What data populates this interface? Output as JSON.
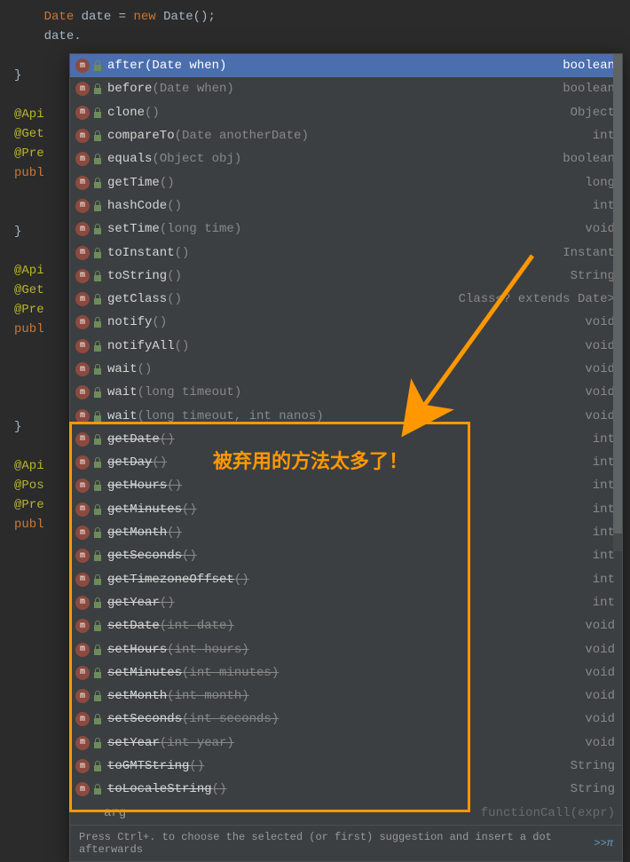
{
  "code": {
    "line1_pre": "    ",
    "line1_type": "Date",
    "line1_var": " date ",
    "line1_eq": "= ",
    "line1_new": "new",
    "line1_call": " Date();",
    "line2_pre": "    ",
    "line2_expr": "date.",
    "brace_close": "}",
    "ann1": "@Api",
    "ann2": "@Get",
    "ann3": "@Pre",
    "ann4": "@Pos",
    "publ": "publ",
    "rest_arg": "arg",
    "rest_fn": "functionCall(expr)"
  },
  "suggestions": [
    {
      "name": "after",
      "params": "(Date when)",
      "ret": "boolean",
      "deprecated": false,
      "selected": true
    },
    {
      "name": "before",
      "params": "(Date when)",
      "ret": "boolean",
      "deprecated": false
    },
    {
      "name": "clone",
      "params": "()",
      "ret": "Object",
      "deprecated": false
    },
    {
      "name": "compareTo",
      "params": "(Date anotherDate)",
      "ret": "int",
      "deprecated": false
    },
    {
      "name": "equals",
      "params": "(Object obj)",
      "ret": "boolean",
      "deprecated": false
    },
    {
      "name": "getTime",
      "params": "()",
      "ret": "long",
      "deprecated": false
    },
    {
      "name": "hashCode",
      "params": "()",
      "ret": "int",
      "deprecated": false
    },
    {
      "name": "setTime",
      "params": "(long time)",
      "ret": "void",
      "deprecated": false
    },
    {
      "name": "toInstant",
      "params": "()",
      "ret": "Instant",
      "deprecated": false
    },
    {
      "name": "toString",
      "params": "()",
      "ret": "String",
      "deprecated": false
    },
    {
      "name": "getClass",
      "params": "()",
      "ret": "Class<? extends Date>",
      "deprecated": false
    },
    {
      "name": "notify",
      "params": "()",
      "ret": "void",
      "deprecated": false
    },
    {
      "name": "notifyAll",
      "params": "()",
      "ret": "void",
      "deprecated": false
    },
    {
      "name": "wait",
      "params": "()",
      "ret": "void",
      "deprecated": false
    },
    {
      "name": "wait",
      "params": "(long timeout)",
      "ret": "void",
      "deprecated": false
    },
    {
      "name": "wait",
      "params": "(long timeout, int nanos)",
      "ret": "void",
      "deprecated": false
    },
    {
      "name": "getDate",
      "params": "()",
      "ret": "int",
      "deprecated": true
    },
    {
      "name": "getDay",
      "params": "()",
      "ret": "int",
      "deprecated": true
    },
    {
      "name": "getHours",
      "params": "()",
      "ret": "int",
      "deprecated": true
    },
    {
      "name": "getMinutes",
      "params": "()",
      "ret": "int",
      "deprecated": true
    },
    {
      "name": "getMonth",
      "params": "()",
      "ret": "int",
      "deprecated": true
    },
    {
      "name": "getSeconds",
      "params": "()",
      "ret": "int",
      "deprecated": true
    },
    {
      "name": "getTimezoneOffset",
      "params": "()",
      "ret": "int",
      "deprecated": true
    },
    {
      "name": "getYear",
      "params": "()",
      "ret": "int",
      "deprecated": true
    },
    {
      "name": "setDate",
      "params": "(int date)",
      "ret": "void",
      "deprecated": true
    },
    {
      "name": "setHours",
      "params": "(int hours)",
      "ret": "void",
      "deprecated": true
    },
    {
      "name": "setMinutes",
      "params": "(int minutes)",
      "ret": "void",
      "deprecated": true
    },
    {
      "name": "setMonth",
      "params": "(int month)",
      "ret": "void",
      "deprecated": true
    },
    {
      "name": "setSeconds",
      "params": "(int seconds)",
      "ret": "void",
      "deprecated": true
    },
    {
      "name": "setYear",
      "params": "(int year)",
      "ret": "void",
      "deprecated": true
    },
    {
      "name": "toGMTString",
      "params": "()",
      "ret": "String",
      "deprecated": true
    },
    {
      "name": "toLocaleString",
      "params": "()",
      "ret": "String",
      "deprecated": true
    }
  ],
  "method_icon_letter": "m",
  "hint": {
    "text": "Press Ctrl+. to choose the selected (or first) suggestion and insert a dot afterwards",
    "link": ">>",
    "pi": "π"
  },
  "annotation_label": "被弃用的方法太多了！"
}
